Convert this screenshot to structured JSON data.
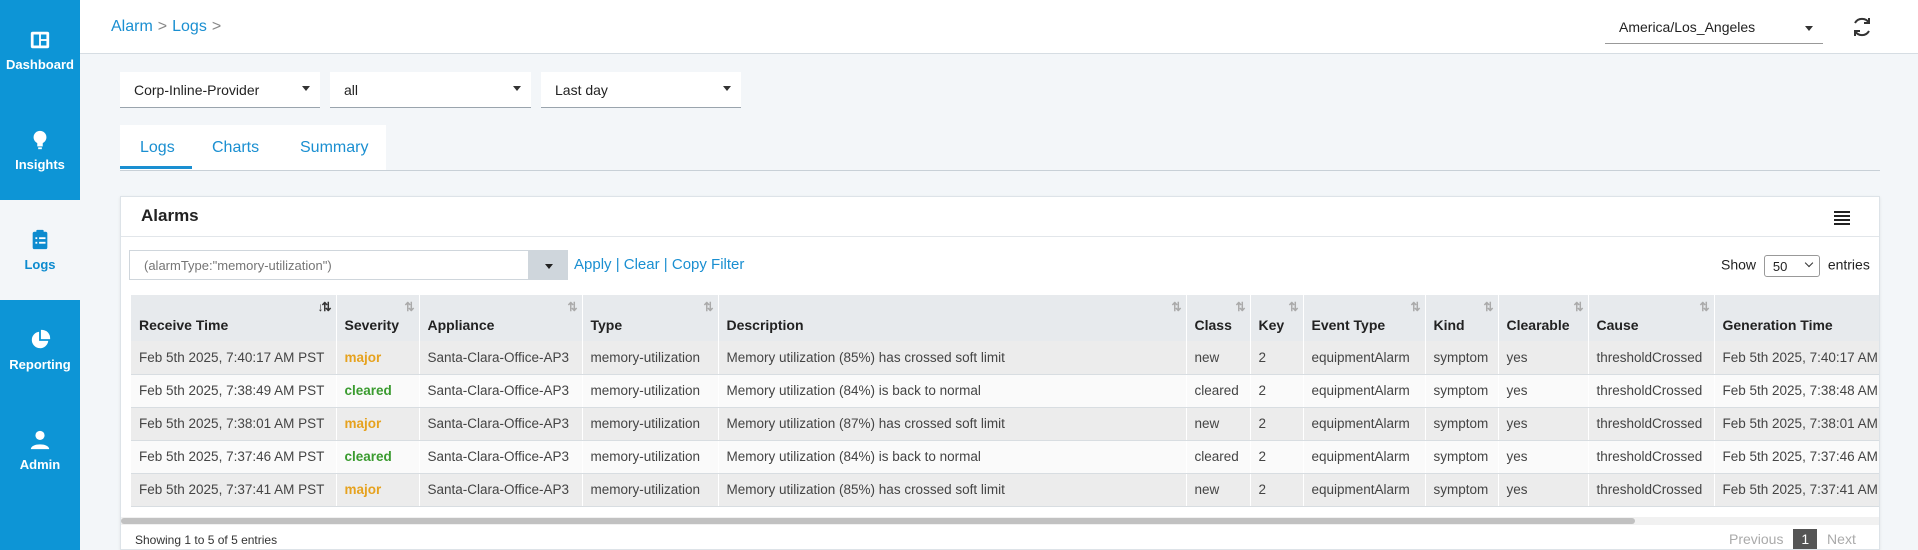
{
  "sidebar": {
    "items": [
      {
        "label": "Dashboard",
        "icon": "dashboard-icon"
      },
      {
        "label": "Insights",
        "icon": "lightbulb-icon"
      },
      {
        "label": "Logs",
        "icon": "clipboard-icon",
        "active": true
      },
      {
        "label": "Reporting",
        "icon": "pie-chart-icon"
      },
      {
        "label": "Admin",
        "icon": "user-icon"
      }
    ]
  },
  "header": {
    "breadcrumb": [
      "Alarm",
      "Logs"
    ],
    "timezone": "America/Los_Angeles",
    "refresh_icon": "refresh-icon"
  },
  "filters": {
    "provider": "Corp-Inline-Provider",
    "appliance": "all",
    "range": "Last day"
  },
  "tabs": [
    "Logs",
    "Charts",
    "Summary"
  ],
  "card": {
    "title": "Alarms",
    "query_placeholder": "(alarmType:\"memory-utilization\")",
    "actions": {
      "apply": "Apply",
      "clear": "| Clear",
      "copy": "| Copy Filter"
    },
    "show_label": "Show",
    "show_value": "50",
    "entries_label": "entries"
  },
  "table": {
    "columns": [
      "Receive Time",
      "Severity",
      "Appliance",
      "Type",
      "Description",
      "Class",
      "Key",
      "Event Type",
      "Kind",
      "Clearable",
      "Cause",
      "Generation Time"
    ],
    "rows": [
      [
        "Feb 5th 2025, 7:40:17 AM PST",
        "major",
        "Santa-Clara-Office-AP3",
        "memory-utilization",
        "Memory utilization (85%) has crossed soft limit",
        "new",
        "2",
        "equipmentAlarm",
        "symptom",
        "yes",
        "thresholdCrossed",
        "Feb 5th 2025, 7:40:17 AM"
      ],
      [
        "Feb 5th 2025, 7:38:49 AM PST",
        "cleared",
        "Santa-Clara-Office-AP3",
        "memory-utilization",
        "Memory utilization (84%) is back to normal",
        "cleared",
        "2",
        "equipmentAlarm",
        "symptom",
        "yes",
        "thresholdCrossed",
        "Feb 5th 2025, 7:38:48 AM"
      ],
      [
        "Feb 5th 2025, 7:38:01 AM PST",
        "major",
        "Santa-Clara-Office-AP3",
        "memory-utilization",
        "Memory utilization (87%) has crossed soft limit",
        "new",
        "2",
        "equipmentAlarm",
        "symptom",
        "yes",
        "thresholdCrossed",
        "Feb 5th 2025, 7:38:01 AM"
      ],
      [
        "Feb 5th 2025, 7:37:46 AM PST",
        "cleared",
        "Santa-Clara-Office-AP3",
        "memory-utilization",
        "Memory utilization (84%) is back to normal",
        "cleared",
        "2",
        "equipmentAlarm",
        "symptom",
        "yes",
        "thresholdCrossed",
        "Feb 5th 2025, 7:37:46 AM"
      ],
      [
        "Feb 5th 2025, 7:37:41 AM PST",
        "major",
        "Santa-Clara-Office-AP3",
        "memory-utilization",
        "Memory utilization (85%) has crossed soft limit",
        "new",
        "2",
        "equipmentAlarm",
        "symptom",
        "yes",
        "thresholdCrossed",
        "Feb 5th 2025, 7:37:41 AM"
      ]
    ]
  },
  "footer": {
    "showing": "Showing 1 to 5 of 5 entries",
    "previous": "Previous",
    "page": "1",
    "next": "Next"
  },
  "colors": {
    "brand": "#0d95d6",
    "link": "#1a8fd1",
    "major": "#e6a21e",
    "cleared": "#3a9b2f"
  }
}
